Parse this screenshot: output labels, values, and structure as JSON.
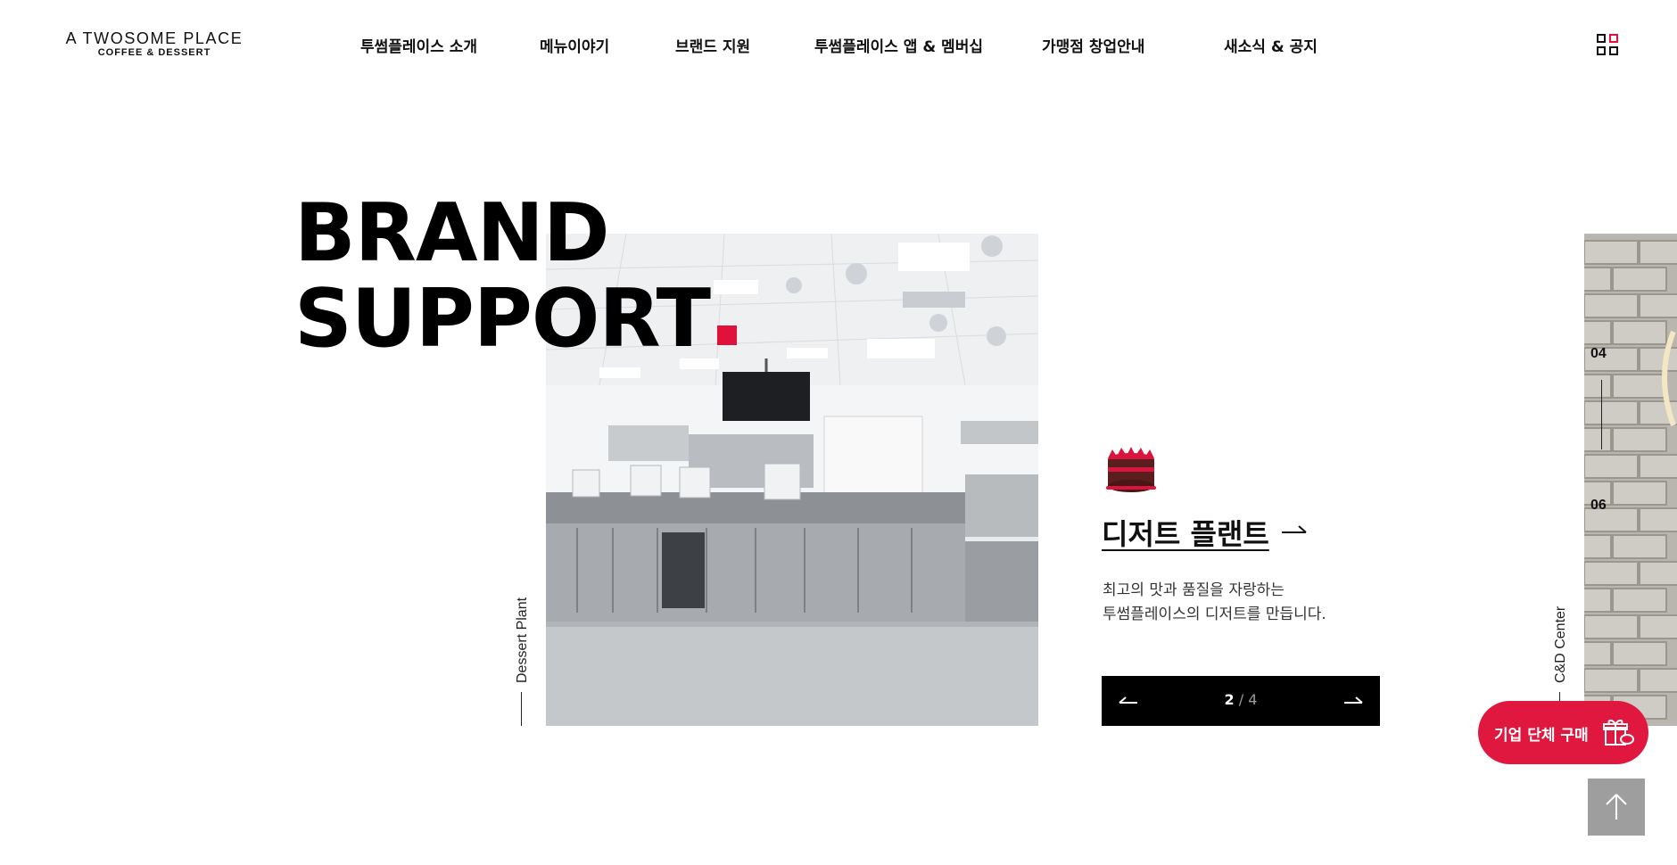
{
  "brand": {
    "logo_line1": "A TWOSOME PLACE",
    "logo_line2": "COFFEE & DESSERT"
  },
  "nav": [
    {
      "label": "투썸플레이스 소개"
    },
    {
      "label": "메뉴이야기"
    },
    {
      "label": "브랜드 지원"
    },
    {
      "label": "투썸플레이스 앱 & 멤버십"
    },
    {
      "label": "가맹점 창업안내"
    },
    {
      "label": "새소식 & 공지"
    }
  ],
  "hero": {
    "line1": "BRAND",
    "line2": "SUPPORT"
  },
  "slide": {
    "side_label": "Dessert Plant",
    "title": "디저트 플랜트",
    "desc_line1": "최고의 맛과 품질을 자랑하는",
    "desc_line2": "투썸플레이스의 디저트를 만듭니다.",
    "current": "2",
    "separator": " / ",
    "total": "4",
    "icon": "cake-icon"
  },
  "next_slide": {
    "num_top": "04",
    "num_bottom": "06",
    "side_label": "C&D Center"
  },
  "floating": {
    "corp_label": "기업 단체 구매"
  },
  "colors": {
    "accent": "#e0113b",
    "corp_button": "#e0173f",
    "pager_bg": "#000000",
    "top_button": "#9e9e9e"
  }
}
